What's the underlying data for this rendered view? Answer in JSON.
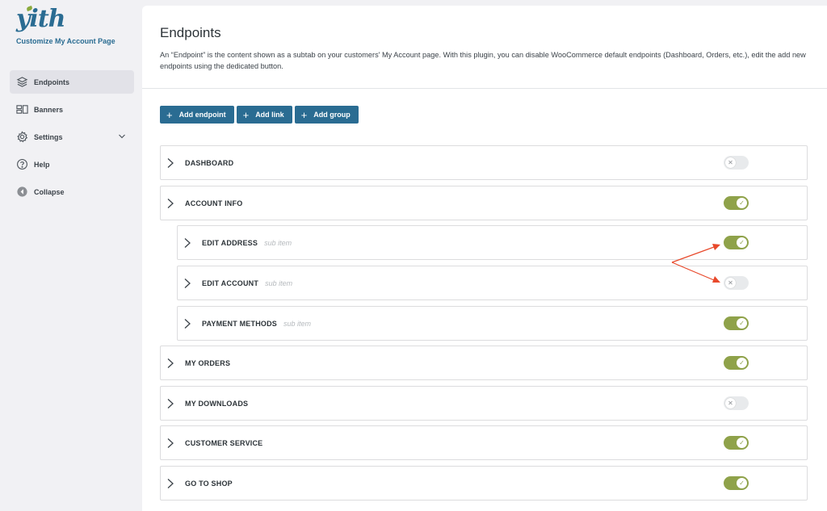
{
  "brand": {
    "logo_text": "yith",
    "app_title": "Customize My Account Page"
  },
  "sidebar": {
    "items": [
      {
        "label": "Endpoints",
        "icon": "layers-icon",
        "active": true
      },
      {
        "label": "Banners",
        "icon": "banners-icon"
      },
      {
        "label": "Settings",
        "icon": "gear-icon",
        "has_submenu": true
      },
      {
        "label": "Help",
        "icon": "help-icon"
      },
      {
        "label": "Collapse",
        "icon": "collapse-icon"
      }
    ]
  },
  "header": {
    "title": "Endpoints",
    "description": "An “Endpoint” is the content shown as a subtab on your customers' My Account page. With this plugin, you can disable WooCommerce default endpoints (Dashboard, Orders, etc.), edit the add new endpoints using the dedicated button."
  },
  "actions": {
    "add_endpoint": "Add endpoint",
    "add_link": "Add link",
    "add_group": "Add group"
  },
  "endpoints": [
    {
      "label": "DASHBOARD",
      "enabled": false
    },
    {
      "label": "ACCOUNT INFO",
      "enabled": true
    },
    {
      "label": "EDIT ADDRESS",
      "sub": "sub item",
      "enabled": true
    },
    {
      "label": "EDIT ACCOUNT",
      "sub": "sub item",
      "enabled": false
    },
    {
      "label": "PAYMENT METHODS",
      "sub": "sub item",
      "enabled": true
    },
    {
      "label": "MY ORDERS",
      "enabled": true
    },
    {
      "label": "MY DOWNLOADS",
      "enabled": false
    },
    {
      "label": "CUSTOMER SERVICE",
      "enabled": true
    },
    {
      "label": "GO TO SHOP",
      "enabled": true
    }
  ],
  "colors": {
    "primary": "#2a6c92",
    "toggle_on": "#8fa24a",
    "toggle_off": "#e8eaec",
    "annotation": "#e8492b"
  }
}
